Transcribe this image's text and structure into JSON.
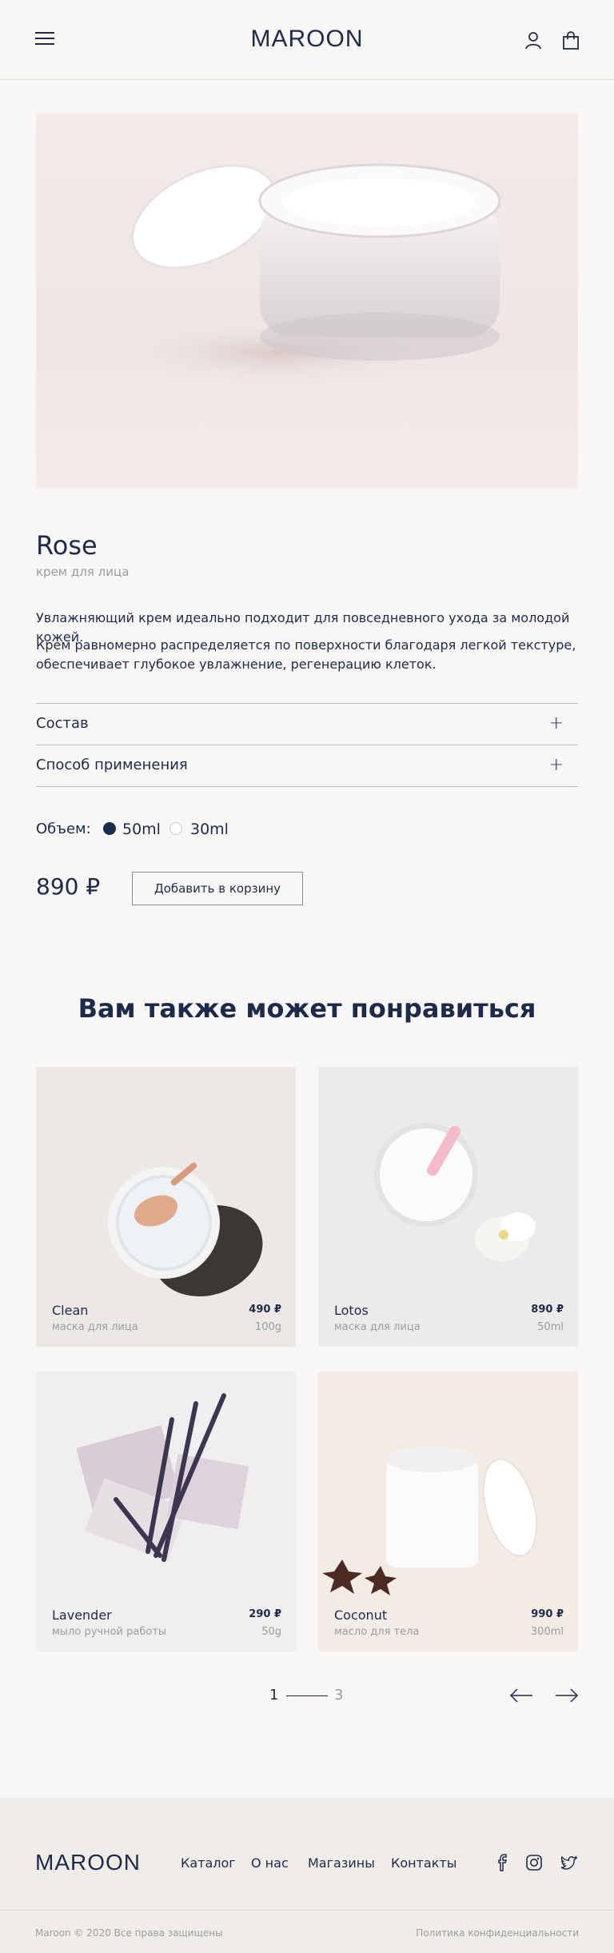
{
  "header": {
    "logo": "MAROON"
  },
  "product": {
    "name": "Rose",
    "subtitle": "крем для лица",
    "description_1": "Увлажняющий крем идеально подходит для повседневного ухода за молодой кожей.",
    "description_2": "Крем равномерно распределяется по поверхности благодаря легкой текстуре, обеспечивает глубокое увлажнение, регенерацию клеток.",
    "accordion": [
      {
        "label": "Состав",
        "icon": "plus-icon"
      },
      {
        "label": "Способ применения",
        "icon": "plus-icon"
      }
    ],
    "volume_label": "Объем:",
    "volume_options": [
      {
        "label": "50ml",
        "selected": true
      },
      {
        "label": "30ml",
        "selected": false
      }
    ],
    "price": "890 ₽",
    "add_to_cart": "Добавить в корзину"
  },
  "recommendations": {
    "title": "Вам также может понравиться",
    "items": [
      {
        "name": "Clean",
        "type": "маска для лица",
        "price": "490 ₽",
        "size": "100g"
      },
      {
        "name": "Lotos",
        "type": "маска для лица",
        "price": "890 ₽",
        "size": "50ml"
      },
      {
        "name": "Lavender",
        "type": "мыло ручной работы",
        "price": "290 ₽",
        "size": "50g"
      },
      {
        "name": "Coconut",
        "type": "масло для тела",
        "price": "990 ₽",
        "size": "300ml"
      }
    ],
    "pagination": {
      "current": "1",
      "total": "3"
    }
  },
  "footer": {
    "logo": "MAROON",
    "nav": [
      "Каталог",
      "О нас",
      "Магазины",
      "Контакты"
    ],
    "social": [
      "facebook-icon",
      "instagram-icon",
      "twitter-icon"
    ],
    "copyright": "Maroon © 2020 Все права защищены",
    "privacy": "Политика конфиденциальности"
  },
  "colors": {
    "accent": "#1d2a4a",
    "background": "#f8f7f5",
    "muted": "#9a9ca3"
  }
}
